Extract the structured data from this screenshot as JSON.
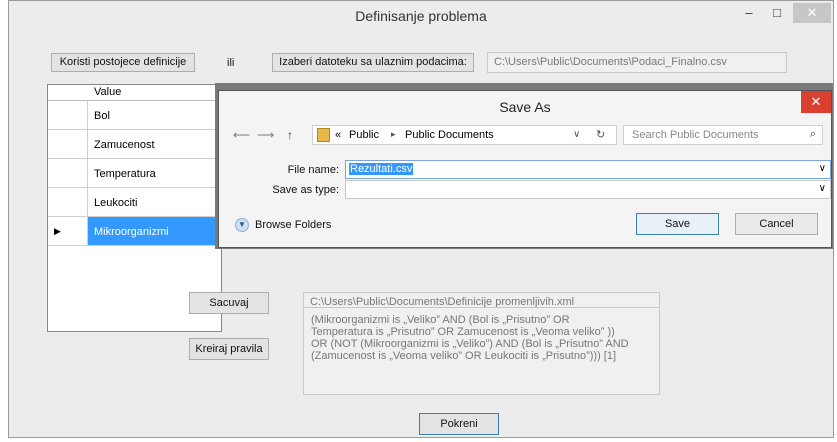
{
  "window": {
    "title": "Definisanje problema",
    "minimize": "–",
    "maximize": "□",
    "close": "✕"
  },
  "top_bar": {
    "use_existing_button": "Koristi postojece definicije",
    "or_label": "ili",
    "choose_file_button": "Izaberi datoteku sa ulaznim podacima:",
    "file_path": "C:\\Users\\Public\\Documents\\Podaci_Finalno.csv"
  },
  "grid": {
    "header": "Value",
    "rows": [
      "Bol",
      "Zamucenost",
      "Temperatura",
      "Leukociti",
      "Mikroorganizmi"
    ],
    "selected_index": 4,
    "row_indicator": "▶"
  },
  "save_row": {
    "save_button": "Sacuvaj",
    "save_path": "C:\\Users\\Public\\Documents\\Definicije promenljivih.xml"
  },
  "rules_row": {
    "create_rules_button": "Kreiraj pravila",
    "rules_text": [
      "(Mikroorganizmi is „Veliko” AND (Bol is „Prisutno” OR",
      "Temperatura is „Prisutno” OR Zamucenost is „Veoma veliko” ))",
      "OR (NOT (Mikroorganizmi is „Veliko”) AND (Bol is „Prisutno” AND",
      "(Zamucenost is „Veoma veliko”  OR Leukociti is „Prisutno”))) [1]"
    ]
  },
  "run_button": "Pokreni",
  "save_dialog": {
    "title": "Save As",
    "close": "✕",
    "back_icon": "⟵",
    "forward_icon": "⟶",
    "up_icon": "↑",
    "path": {
      "prefix": "«",
      "parts": [
        "Public",
        "Public Documents"
      ],
      "sep": "▸"
    },
    "search_placeholder": "Search Public Documents",
    "file_name_label": "File name:",
    "file_name_value": "Rezultati.csv",
    "save_as_type_label": "Save as type:",
    "save_as_type_value": "",
    "browse_folders": "Browse Folders",
    "save_button": "Save",
    "cancel_button": "Cancel"
  }
}
